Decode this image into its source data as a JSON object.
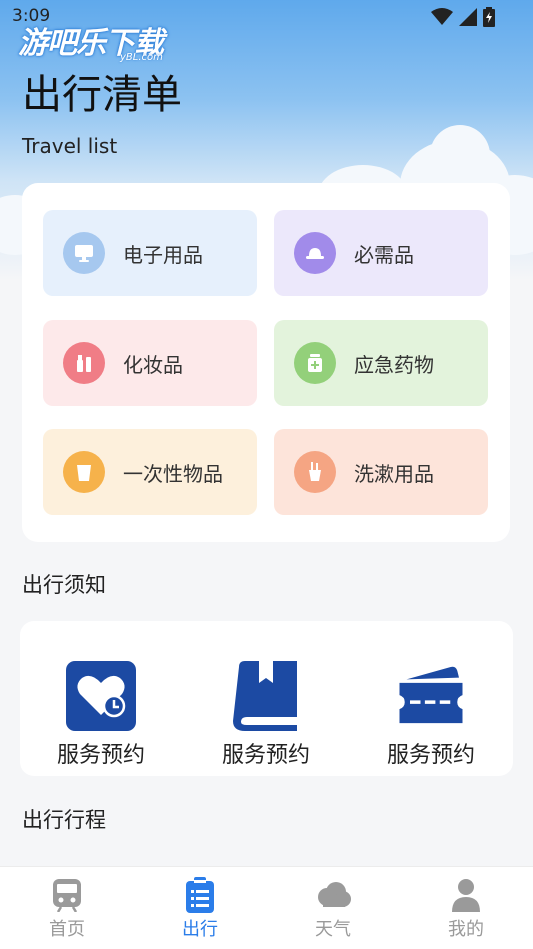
{
  "status_bar": {
    "time": "3:09"
  },
  "watermark": {
    "text": "游吧乐下载",
    "sub": "yBL.com"
  },
  "header": {
    "title": "出行清单",
    "subtitle": "Travel list"
  },
  "categories": [
    {
      "label": "电子用品",
      "icon": "monitor-icon",
      "bg": "#e6f0fc",
      "icon_bg": "#a6c8ef"
    },
    {
      "label": "必需品",
      "icon": "hat-icon",
      "bg": "#ece8fb",
      "icon_bg": "#a18bea"
    },
    {
      "label": "化妆品",
      "icon": "cosmetics-icon",
      "bg": "#fde9ea",
      "icon_bg": "#f07d86"
    },
    {
      "label": "应急药物",
      "icon": "medicine-icon",
      "bg": "#e3f3dc",
      "icon_bg": "#93d07a"
    },
    {
      "label": "一次性物品",
      "icon": "cup-icon",
      "bg": "#fdf0dc",
      "icon_bg": "#f6b24b"
    },
    {
      "label": "洗漱用品",
      "icon": "toiletries-icon",
      "bg": "#fde4da",
      "icon_bg": "#f5a583"
    }
  ],
  "sections": {
    "notice": "出行须知",
    "itinerary": "出行行程"
  },
  "services": [
    {
      "label": "服务预约",
      "icon": "heart-clock-icon"
    },
    {
      "label": "服务预约",
      "icon": "book-icon"
    },
    {
      "label": "服务预约",
      "icon": "ticket-icon"
    }
  ],
  "tabs": [
    {
      "label": "首页",
      "icon": "train-icon",
      "active": false
    },
    {
      "label": "出行",
      "icon": "clipboard-list-icon",
      "active": true
    },
    {
      "label": "天气",
      "icon": "cloud-icon",
      "active": false
    },
    {
      "label": "我的",
      "icon": "person-icon",
      "active": false
    }
  ],
  "colors": {
    "accent": "#2b7de9",
    "service_blue": "#1c4aa3",
    "inactive": "#9a9a9a"
  }
}
